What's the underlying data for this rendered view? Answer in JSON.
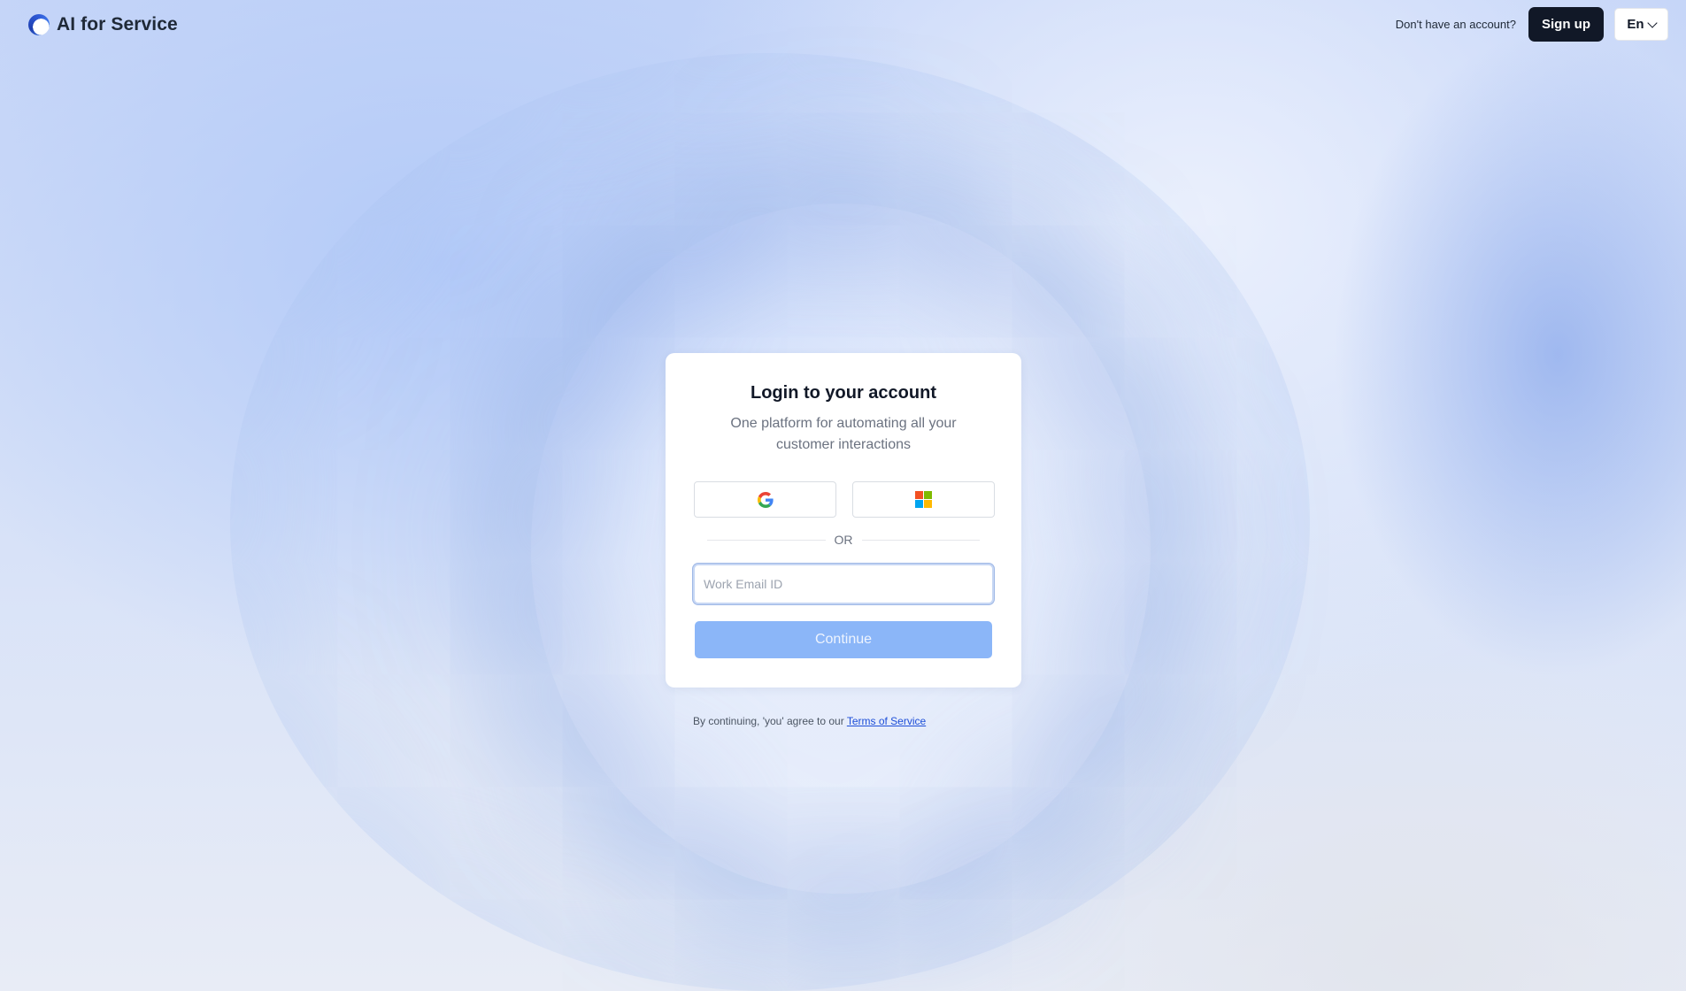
{
  "header": {
    "brand": "AI for Service",
    "no_account_text": "Don't have an account?",
    "signup_label": "Sign up",
    "language": "En"
  },
  "card": {
    "title": "Login to your account",
    "subtitle": "One platform for automating all your customer interactions",
    "sso": {
      "google_icon": "google-icon",
      "microsoft_icon": "microsoft-icon"
    },
    "divider_text": "OR",
    "email_placeholder": "Work Email ID",
    "email_value": "",
    "continue_label": "Continue"
  },
  "footer": {
    "terms_prefix": "By continuing, 'you' agree to our",
    "terms_link": "Terms of Service"
  },
  "colors": {
    "primary_dark": "#111827",
    "continue_disabled": "#8bb6f8",
    "link": "#1d4ed8"
  }
}
